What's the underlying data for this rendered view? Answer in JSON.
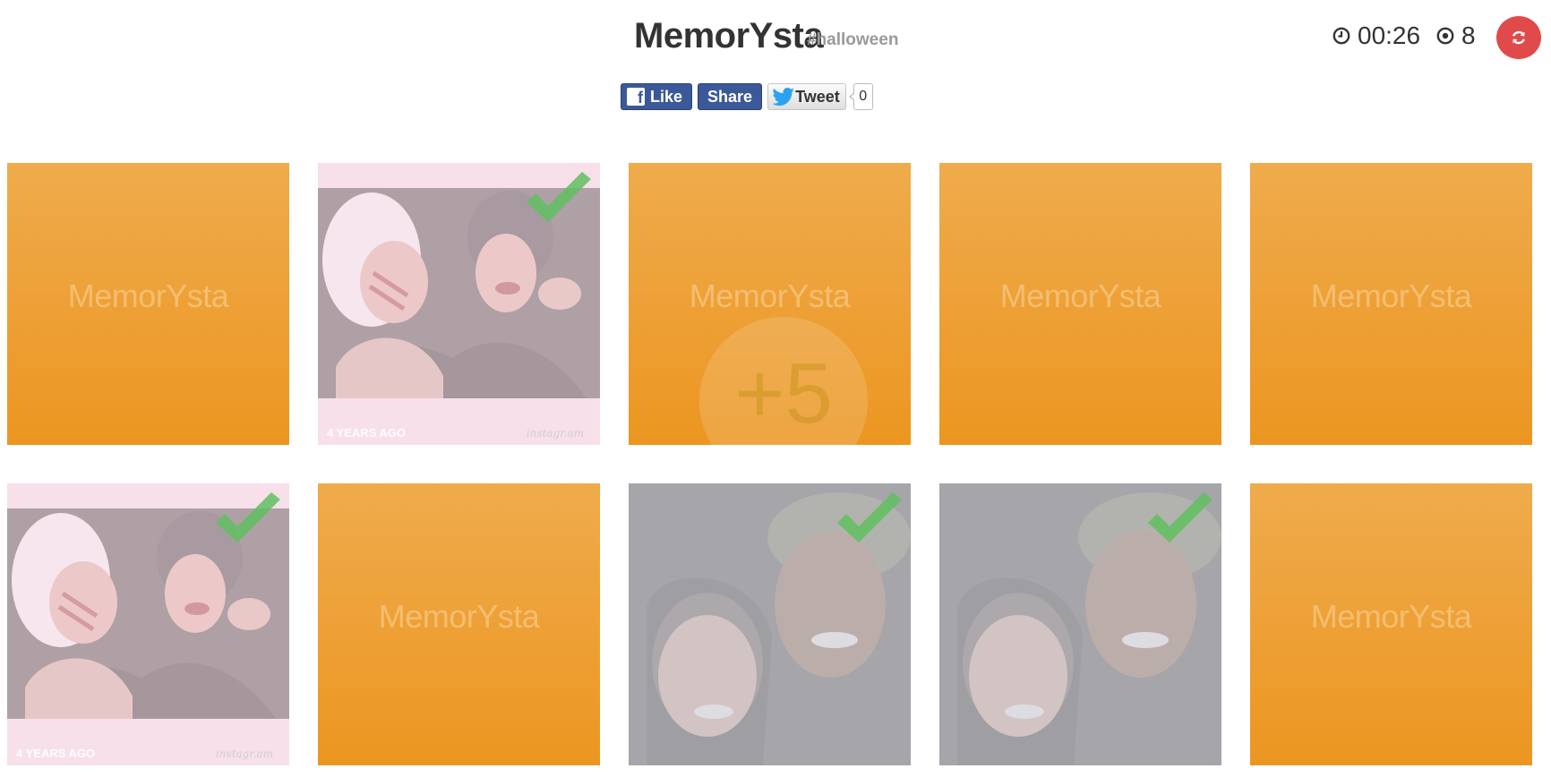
{
  "header": {
    "title": "MemorYsta",
    "hashtag": "#halloween",
    "timer": "00:26",
    "moves": "8"
  },
  "social": {
    "like": "Like",
    "share": "Share",
    "tweet": "Tweet",
    "tweet_count": "0"
  },
  "colors": {
    "card_back_top": "#efab4c",
    "card_back_bottom": "#ec9621",
    "refresh_button": "#e14a4a",
    "check": "#5fbf5f"
  },
  "board": {
    "back_label": "MemorYsta",
    "bonus_text": "+5",
    "cards": [
      {
        "state": "hidden"
      },
      {
        "state": "matched",
        "image": "two-women-halloween-makeup",
        "meta": "4 YEARS AGO"
      },
      {
        "state": "hidden",
        "bonus": true
      },
      {
        "state": "hidden"
      },
      {
        "state": "hidden"
      },
      {
        "state": "matched",
        "image": "two-women-halloween-makeup",
        "meta": "4 YEARS AGO"
      },
      {
        "state": "hidden"
      },
      {
        "state": "matched",
        "image": "couple-selfie-camo-hat"
      },
      {
        "state": "matched",
        "image": "couple-selfie-camo-hat"
      },
      {
        "state": "hidden"
      }
    ]
  }
}
